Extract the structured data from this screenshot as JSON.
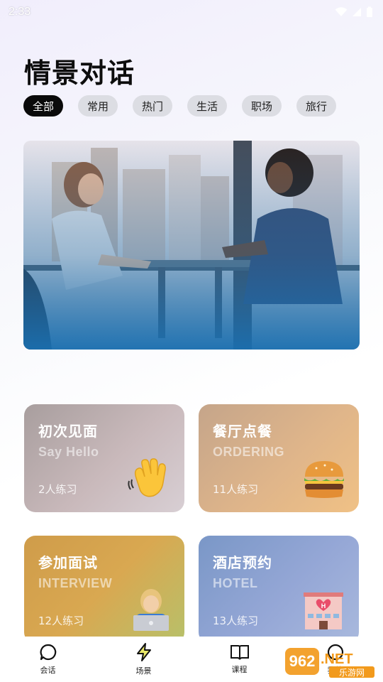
{
  "status": {
    "time": "2:33"
  },
  "page": {
    "title": "情景对话"
  },
  "filters": [
    {
      "label": "全部",
      "active": true
    },
    {
      "label": "常用",
      "active": false
    },
    {
      "label": "热门",
      "active": false
    },
    {
      "label": "生活",
      "active": false
    },
    {
      "label": "职场",
      "active": false
    },
    {
      "label": "旅行",
      "active": false
    }
  ],
  "cards": [
    {
      "title": "初次见面",
      "subtitle": "Say Hello",
      "count": "2人练习",
      "icon": "waving-hand-icon"
    },
    {
      "title": "餐厅点餐",
      "subtitle": "ORDERING",
      "count": "11人练习",
      "icon": "burger-icon"
    },
    {
      "title": "参加面试",
      "subtitle": "INTERVIEW",
      "count": "12人练习",
      "icon": "person-laptop-icon"
    },
    {
      "title": "酒店预约",
      "subtitle": "HOTEL",
      "count": "13人练习",
      "icon": "hotel-icon"
    }
  ],
  "nav": [
    {
      "label": "会话",
      "icon": "chat-bubble-icon"
    },
    {
      "label": "场景",
      "icon": "lightning-icon"
    },
    {
      "label": "课程",
      "icon": "book-icon"
    },
    {
      "label": "我的",
      "icon": "profile-icon"
    }
  ],
  "watermark": {
    "text_big": "962.NET",
    "text_small": "乐游网"
  }
}
